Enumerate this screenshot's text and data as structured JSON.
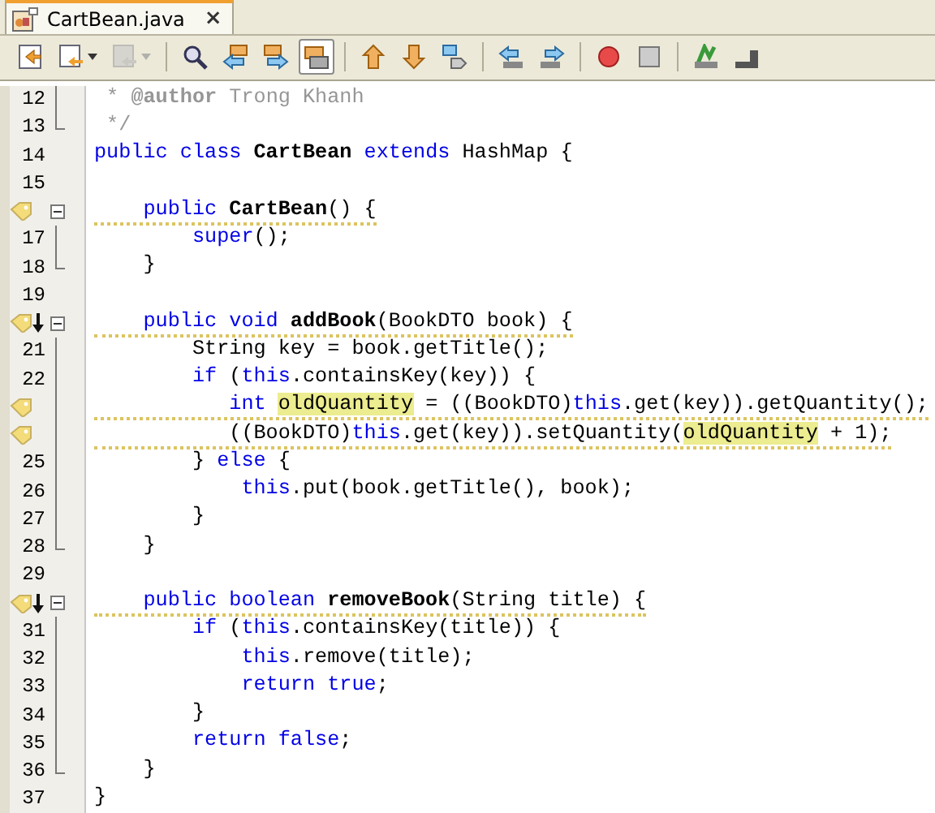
{
  "tab": {
    "title": "CartBean.java",
    "close": "×",
    "selected": true
  },
  "toolbar": [
    {
      "selected": false,
      "disabled": false,
      "dropdown": false
    },
    {
      "selected": false,
      "disabled": false,
      "dropdown": true
    },
    {
      "selected": false,
      "disabled": true,
      "dropdown": true
    },
    {
      "selected": false,
      "disabled": false,
      "dropdown": false
    },
    {
      "selected": false,
      "disabled": false,
      "dropdown": false
    },
    {
      "selected": false,
      "disabled": false,
      "dropdown": false
    },
    {
      "selected": true,
      "disabled": false,
      "dropdown": false
    },
    {
      "selected": false,
      "disabled": false,
      "dropdown": false
    },
    {
      "selected": false,
      "disabled": false,
      "dropdown": false
    },
    {
      "selected": false,
      "disabled": false,
      "dropdown": false
    },
    {
      "selected": false,
      "disabled": false,
      "dropdown": false
    },
    {
      "selected": false,
      "disabled": false,
      "dropdown": false
    },
    {
      "selected": false,
      "disabled": false,
      "dropdown": false
    },
    {
      "selected": false,
      "disabled": false,
      "dropdown": false
    },
    {
      "selected": false,
      "disabled": false,
      "dropdown": false
    },
    {
      "selected": false,
      "disabled": false,
      "dropdown": false
    }
  ],
  "lines": [
    {
      "number": "12",
      "kind": "fold-body",
      "hint": false,
      "arrow": false,
      "warning": false,
      "tokens": [
        {
          "kind": "comment",
          "text": " * "
        },
        {
          "kind": "tag",
          "text": "@author"
        },
        {
          "kind": "comment",
          "text": " Trong Khanh"
        }
      ]
    },
    {
      "number": "13",
      "kind": "fold-end",
      "hint": false,
      "arrow": false,
      "warning": false,
      "tokens": [
        {
          "kind": "comment",
          "text": " */"
        }
      ]
    },
    {
      "number": "14",
      "kind": "plain",
      "hint": false,
      "arrow": false,
      "warning": false,
      "tokens": [
        {
          "kind": "keyword",
          "text": "public class "
        },
        {
          "kind": "bold",
          "text": "CartBean"
        },
        {
          "kind": "keyword",
          "text": " extends "
        },
        {
          "kind": "plain",
          "text": "HashMap {"
        }
      ]
    },
    {
      "number": "15",
      "kind": "plain",
      "hint": false,
      "arrow": false
    },
    {
      "kind": "fold-start",
      "hint": true,
      "arrow": false,
      "warning": true,
      "tokens": [
        {
          "kind": "keyword",
          "text": "    public "
        },
        {
          "kind": "bold",
          "text": "CartBean"
        },
        {
          "kind": "plain",
          "text": "() {"
        }
      ]
    },
    {
      "number": "17",
      "kind": "fold-body",
      "hint": false,
      "arrow": false,
      "warning": false,
      "tokens": [
        {
          "kind": "keyword",
          "text": "        super"
        },
        {
          "kind": "plain",
          "text": "();"
        }
      ]
    },
    {
      "number": "18",
      "kind": "fold-end",
      "hint": false,
      "arrow": false,
      "warning": false,
      "tokens": [
        {
          "kind": "plain",
          "text": "    }"
        }
      ]
    },
    {
      "number": "19",
      "kind": "plain",
      "hint": false,
      "arrow": false
    },
    {
      "kind": "fold-start",
      "hint": true,
      "arrow": true,
      "warning": true,
      "tokens": [
        {
          "kind": "keyword",
          "text": "    public void "
        },
        {
          "kind": "bold",
          "text": "addBook"
        },
        {
          "kind": "plain",
          "text": "(BookDTO book) {"
        }
      ]
    },
    {
      "number": "21",
      "kind": "fold-body",
      "hint": false,
      "arrow": false,
      "warning": false,
      "tokens": [
        {
          "kind": "plain",
          "text": "        String key = book.getTitle();"
        }
      ]
    },
    {
      "number": "22",
      "kind": "fold-body",
      "hint": false,
      "arrow": false,
      "warning": false,
      "tokens": [
        {
          "kind": "keyword",
          "text": "        if"
        },
        {
          "kind": "plain",
          "text": " ("
        },
        {
          "kind": "keyword",
          "text": "this"
        },
        {
          "kind": "plain",
          "text": ".containsKey(key)) {"
        }
      ]
    },
    {
      "kind": "fold-body",
      "hint": true,
      "arrow": false,
      "warning": true,
      "tokens": [
        {
          "kind": "keyword",
          "text": "           int "
        },
        {
          "kind": "highlight",
          "text": "oldQuantity"
        },
        {
          "kind": "plain",
          "text": " = ((BookDTO)"
        },
        {
          "kind": "keyword",
          "text": "this"
        },
        {
          "kind": "plain",
          "text": ".get(key)).getQuantity();"
        }
      ]
    },
    {
      "kind": "fold-body",
      "hint": true,
      "arrow": false,
      "warning": true,
      "tokens": [
        {
          "kind": "plain",
          "text": "           ((BookDTO)"
        },
        {
          "kind": "keyword",
          "text": "this"
        },
        {
          "kind": "plain",
          "text": ".get(key)).setQuantity("
        },
        {
          "kind": "highlight",
          "text": "oldQuantity"
        },
        {
          "kind": "plain",
          "text": " + 1);"
        }
      ]
    },
    {
      "number": "25",
      "kind": "fold-body",
      "hint": false,
      "arrow": false,
      "warning": false,
      "tokens": [
        {
          "kind": "plain",
          "text": "        } "
        },
        {
          "kind": "keyword",
          "text": "else"
        },
        {
          "kind": "plain",
          "text": " {"
        }
      ]
    },
    {
      "number": "26",
      "kind": "fold-body",
      "hint": false,
      "arrow": false,
      "warning": false,
      "tokens": [
        {
          "kind": "keyword",
          "text": "            this"
        },
        {
          "kind": "plain",
          "text": ".put(book.getTitle(), book);"
        }
      ]
    },
    {
      "number": "27",
      "kind": "fold-body",
      "hint": false,
      "arrow": false,
      "warning": false,
      "tokens": [
        {
          "kind": "plain",
          "text": "        }"
        }
      ]
    },
    {
      "number": "28",
      "kind": "fold-end",
      "hint": false,
      "arrow": false,
      "warning": false,
      "tokens": [
        {
          "kind": "plain",
          "text": "    }"
        }
      ]
    },
    {
      "number": "29",
      "kind": "plain",
      "hint": false,
      "arrow": false
    },
    {
      "kind": "fold-start",
      "hint": true,
      "arrow": true,
      "warning": true,
      "tokens": [
        {
          "kind": "keyword",
          "text": "    public boolean "
        },
        {
          "kind": "bold",
          "text": "removeBook"
        },
        {
          "kind": "plain",
          "text": "(String title) {"
        }
      ]
    },
    {
      "number": "31",
      "kind": "fold-body",
      "hint": false,
      "arrow": false,
      "warning": false,
      "tokens": [
        {
          "kind": "keyword",
          "text": "        if"
        },
        {
          "kind": "plain",
          "text": " ("
        },
        {
          "kind": "keyword",
          "text": "this"
        },
        {
          "kind": "plain",
          "text": ".containsKey(title)) {"
        }
      ]
    },
    {
      "number": "32",
      "kind": "fold-body",
      "hint": false,
      "arrow": false,
      "warning": false,
      "tokens": [
        {
          "kind": "keyword",
          "text": "            this"
        },
        {
          "kind": "plain",
          "text": ".remove(title);"
        }
      ]
    },
    {
      "number": "33",
      "kind": "fold-body",
      "hint": false,
      "arrow": false,
      "warning": false,
      "tokens": [
        {
          "kind": "keyword",
          "text": "            return true"
        },
        {
          "kind": "plain",
          "text": ";"
        }
      ]
    },
    {
      "number": "34",
      "kind": "fold-body",
      "hint": false,
      "arrow": false,
      "warning": false,
      "tokens": [
        {
          "kind": "plain",
          "text": "        }"
        }
      ]
    },
    {
      "number": "35",
      "kind": "fold-body",
      "hint": false,
      "arrow": false,
      "warning": false,
      "tokens": [
        {
          "kind": "keyword",
          "text": "        return false"
        },
        {
          "kind": "plain",
          "text": ";"
        }
      ]
    },
    {
      "number": "36",
      "kind": "fold-end",
      "hint": false,
      "arrow": false,
      "warning": false,
      "tokens": [
        {
          "kind": "plain",
          "text": "    }"
        }
      ]
    },
    {
      "number": "37",
      "kind": "plain",
      "hint": false,
      "arrow": false,
      "warning": false,
      "tokens": [
        {
          "kind": "plain",
          "text": "}"
        }
      ]
    }
  ]
}
